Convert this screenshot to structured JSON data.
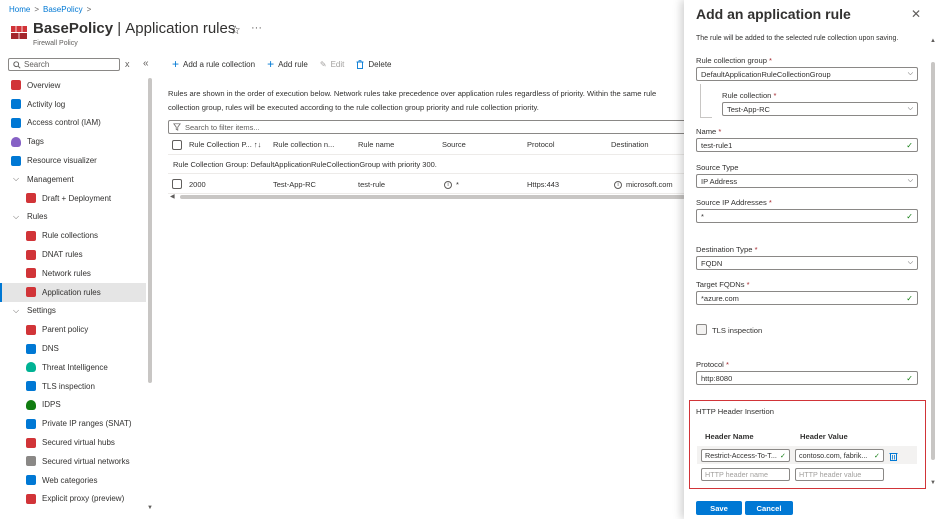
{
  "breadcrumb": {
    "home": "Home",
    "sep": ">",
    "policy": "BasePolicy",
    "sep2": ">"
  },
  "header": {
    "name": "BasePolicy",
    "separator": " | ",
    "page": "Application rules",
    "subtitle": "Firewall Policy",
    "star": "☆",
    "more": "···"
  },
  "sidebar": {
    "search_placeholder": "Search",
    "clear": "x",
    "collapse": "«",
    "items": [
      {
        "label": "Overview",
        "icon": "overview-icon",
        "color": "#d13438"
      },
      {
        "label": "Activity log",
        "icon": "activity-log-icon",
        "color": "#0078d4"
      },
      {
        "label": "Access control (IAM)",
        "icon": "iam-icon",
        "color": "#0078d4"
      },
      {
        "label": "Tags",
        "icon": "tag-icon",
        "color": "#8661c5"
      },
      {
        "label": "Resource visualizer",
        "icon": "visualizer-icon",
        "color": "#0078d4"
      },
      {
        "label": "Management",
        "icon": "chevron-down-icon"
      },
      {
        "label": "Draft + Deployment",
        "icon": "draft-icon",
        "color": "#d13438"
      },
      {
        "label": "Rules",
        "icon": "chevron-down-icon"
      },
      {
        "label": "Rule collections",
        "icon": "rule-collections-icon",
        "color": "#d13438"
      },
      {
        "label": "DNAT rules",
        "icon": "dnat-icon",
        "color": "#d13438"
      },
      {
        "label": "Network rules",
        "icon": "network-rules-icon",
        "color": "#d13438"
      },
      {
        "label": "Application rules",
        "icon": "application-rules-icon",
        "color": "#d13438"
      },
      {
        "label": "Settings",
        "icon": "chevron-down-icon"
      },
      {
        "label": "Parent policy",
        "icon": "parent-policy-icon",
        "color": "#d13438"
      },
      {
        "label": "DNS",
        "icon": "dns-icon",
        "color": "#0078d4"
      },
      {
        "label": "Threat Intelligence",
        "icon": "threat-icon",
        "color": "#00b294"
      },
      {
        "label": "TLS inspection",
        "icon": "tls-icon",
        "color": "#0078d4"
      },
      {
        "label": "IDPS",
        "icon": "idps-icon",
        "color": "#107c10"
      },
      {
        "label": "Private IP ranges (SNAT)",
        "icon": "ip-ranges-icon",
        "color": "#0078d4"
      },
      {
        "label": "Secured virtual hubs",
        "icon": "hubs-icon",
        "color": "#d13438"
      },
      {
        "label": "Secured virtual networks",
        "icon": "vnet-icon",
        "color": "#8a8886"
      },
      {
        "label": "Web categories",
        "icon": "web-icon",
        "color": "#0078d4"
      },
      {
        "label": "Explicit proxy (preview)",
        "icon": "proxy-icon",
        "color": "#d13438"
      }
    ]
  },
  "toolbar": {
    "add_collection": "Add a rule collection",
    "add_rule": "Add rule",
    "edit": "Edit",
    "delete": "Delete"
  },
  "main": {
    "description": "Rules are shown in the order of execution below. Network rules take precedence over application rules regardless of priority. Within the same rule collection group, rules will be executed according to the rule collection group priority and rule collection priority.",
    "filter_placeholder": "Search to filter items...",
    "columns": [
      "Rule Collection P...",
      "Rule collection n...",
      "Rule name",
      "Source",
      "Protocol",
      "Destination"
    ],
    "group": "Rule Collection Group: DefaultApplicationRuleCollectionGroup with priority 300.",
    "row": {
      "priority": "2000",
      "collection": "Test-App-RC",
      "rule": "test-rule",
      "source": "*",
      "protocol": "Https:443",
      "destination": "microsoft.com"
    }
  },
  "panel": {
    "title": "Add an application rule",
    "note": "The rule will be added to the selected rule collection upon saving.",
    "rcg_label": "Rule collection group",
    "rcg_value": "DefaultApplicationRuleCollectionGroup",
    "rc_label": "Rule collection",
    "rc_value": "Test-App-RC",
    "name_label": "Name",
    "name_value": "test-rule1",
    "source_type_label": "Source Type",
    "source_type_value": "IP Address",
    "source_ip_label": "Source IP Addresses",
    "source_ip_value": "*",
    "dest_type_label": "Destination Type",
    "dest_type_value": "FQDN",
    "fqdn_label": "Target FQDNs",
    "fqdn_value": "*azure.com",
    "tls_label": "TLS inspection",
    "protocol_label": "Protocol",
    "protocol_value": "http:8080",
    "required_mark": "*",
    "header_insertion": "HTTP Header Insertion",
    "header_name_col": "Header Name",
    "header_value_col": "Header Value",
    "header_name_value": "Restrict-Access-To-T...",
    "header_value_value": "contoso.com, fabrik...",
    "header_name_placeholder": "HTTP header name",
    "header_value_placeholder": "HTTP header value",
    "save": "Save",
    "cancel": "Cancel"
  },
  "colors": {
    "accent": "#0078d4",
    "valid": "#107c10",
    "highlight_border": "#d13438",
    "required": "#a4262c"
  }
}
